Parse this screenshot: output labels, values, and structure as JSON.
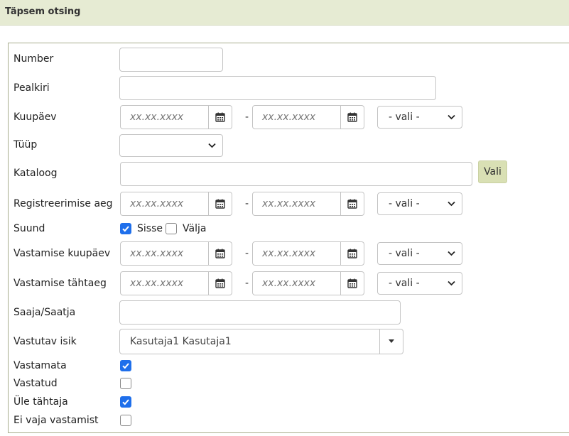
{
  "header": {
    "title": "Täpsem otsing"
  },
  "date_placeholder": "xx.xx.xxxx",
  "dash": "-",
  "select_default": "- vali -",
  "labels": {
    "number": "Number",
    "title": "Pealkiri",
    "date": "Kuupäev",
    "type": "Tüüp",
    "catalog": "Kataloog",
    "registration_time": "Registreerimise aeg",
    "direction": "Suund",
    "reply_date": "Vastamise kuupäev",
    "reply_deadline": "Vastamise tähtaeg",
    "recipient_sender": "Saaja/Saatja",
    "responsible": "Vastutav isik",
    "unanswered": "Vastamata",
    "answered": "Vastatud",
    "overdue": "Üle tähtaja",
    "no_reply_needed": "Ei vaja vastamist"
  },
  "catalog_button": "Vali",
  "direction_options": [
    {
      "label": "Sisse",
      "checked": true
    },
    {
      "label": "Välja",
      "checked": false
    }
  ],
  "responsible_value": "Kasutaja1 Kasutaja1",
  "checkboxes": {
    "unanswered": true,
    "answered": false,
    "overdue": true,
    "no_reply_needed": false
  },
  "colors": {
    "accent": "#1f6feb",
    "header_bg": "#e6ebd3",
    "button_bg": "#d9e0b4"
  },
  "icons": {
    "calendar": "calendar-icon",
    "chevron": "chevron-down-icon",
    "check": "check-icon"
  }
}
